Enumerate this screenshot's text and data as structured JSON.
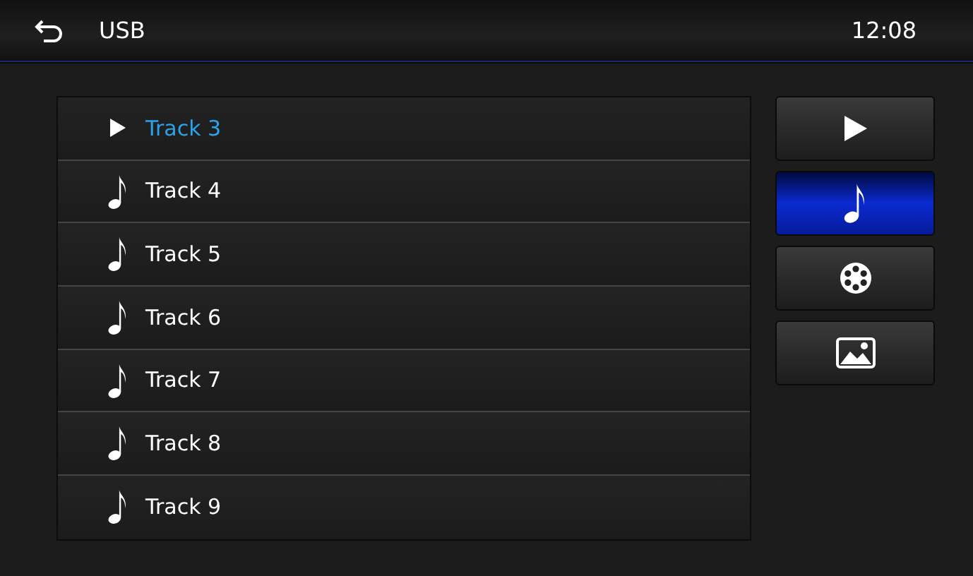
{
  "header": {
    "title": "USB",
    "time": "12:08"
  },
  "tracks": [
    {
      "title": "Track 3",
      "playing": true
    },
    {
      "title": "Track 4",
      "playing": false
    },
    {
      "title": "Track 5",
      "playing": false
    },
    {
      "title": "Track 6",
      "playing": false
    },
    {
      "title": "Track 7",
      "playing": false
    },
    {
      "title": "Track 8",
      "playing": false
    },
    {
      "title": "Track 9",
      "playing": false
    }
  ],
  "side_buttons": [
    {
      "kind": "play",
      "selected": false
    },
    {
      "kind": "music",
      "selected": true
    },
    {
      "kind": "video",
      "selected": false
    },
    {
      "kind": "picture",
      "selected": false
    }
  ]
}
